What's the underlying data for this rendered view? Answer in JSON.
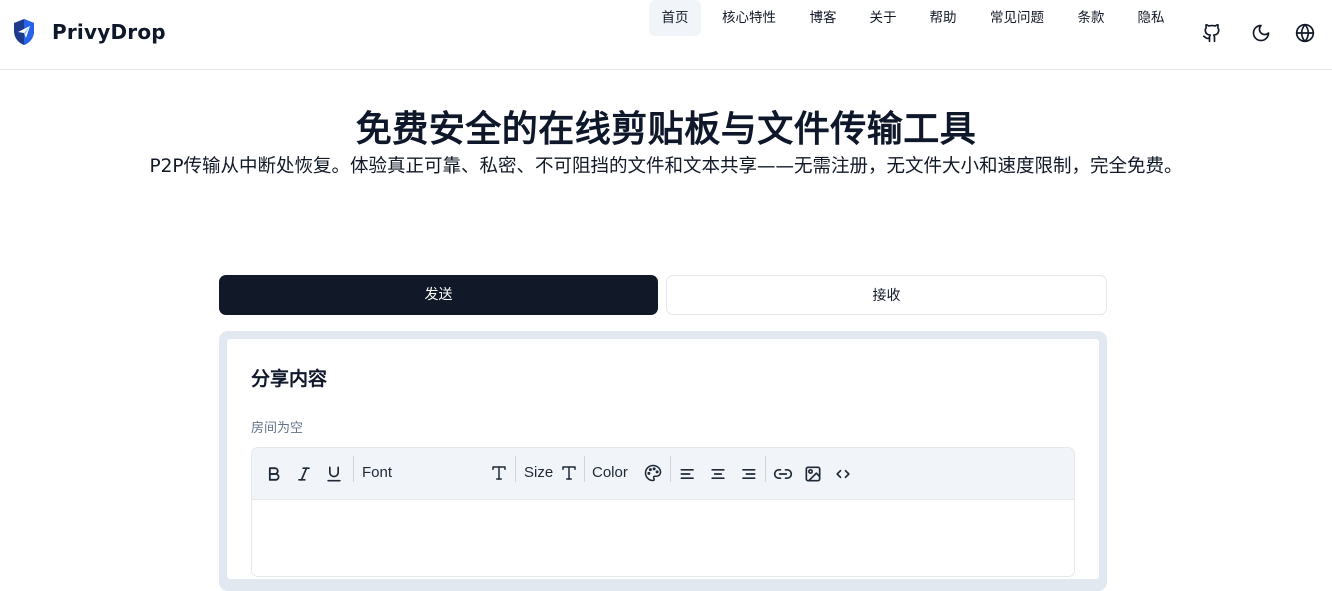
{
  "header": {
    "brand_name": "PrivyDrop",
    "nav": [
      {
        "label": "首页",
        "active": true
      },
      {
        "label": "核心特性",
        "active": false
      },
      {
        "label": "博客",
        "active": false
      },
      {
        "label": "关于",
        "active": false
      },
      {
        "label": "帮助",
        "active": false
      },
      {
        "label": "常见问题",
        "active": false
      },
      {
        "label": "条款",
        "active": false
      },
      {
        "label": "隐私",
        "active": false
      }
    ],
    "icons": [
      "github-icon",
      "moon-icon",
      "globe-icon"
    ]
  },
  "hero": {
    "title": "免费安全的在线剪贴板与文件传输工具",
    "subtitle": "P2P传输从中断处恢复。体验真正可靠、私密、不可阻挡的文件和文本共享——无需注册，无文件大小和速度限制，完全免费。"
  },
  "tabs": {
    "send_label": "发送",
    "receive_label": "接收",
    "active": "send"
  },
  "card": {
    "title": "分享内容",
    "room_status": "房间为空"
  },
  "editor": {
    "font_label": "Font",
    "size_label": "Size",
    "color_label": "Color",
    "toolbar_icons": [
      "bold-icon",
      "italic-icon",
      "underline-icon",
      "font-icon",
      "text-size-icon",
      "palette-icon",
      "align-left-icon",
      "align-center-icon",
      "align-right-icon",
      "link-icon",
      "image-icon",
      "code-icon"
    ]
  },
  "colors": {
    "primary": "#111827",
    "accent_bg": "#f1f5f9",
    "card_border": "#e2e8f0",
    "muted_text": "#64748b"
  }
}
